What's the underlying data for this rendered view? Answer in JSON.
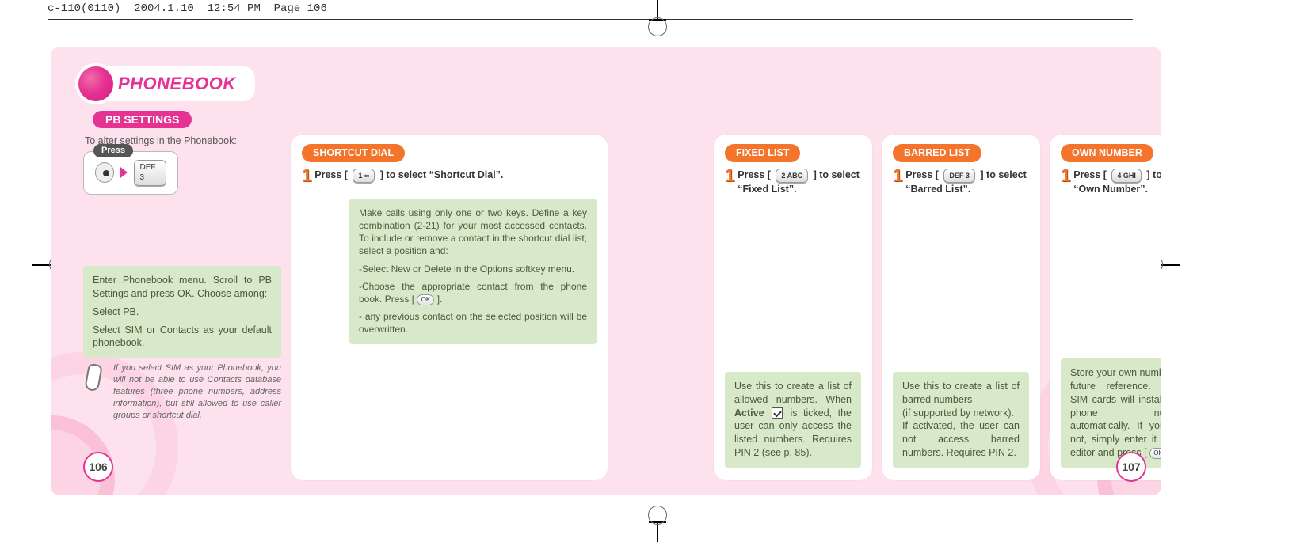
{
  "file_header": "c-110(0110)  2004.1.10  12:54 PM  Page 106",
  "title": "PHONEBOOK",
  "section": "PB SETTINGS",
  "page_left": "106",
  "page_right": "107",
  "intro": {
    "alter": "To alter settings in the Phonebook:",
    "press_label": "Press",
    "key_text": "DEF 3"
  },
  "enter_box": {
    "p1": "Enter Phonebook menu. Scroll to PB Settings and press OK. Choose among:",
    "p2": "Select PB.",
    "p3": "Select SIM or Contacts as your default phonebook."
  },
  "sim_note": "If you select SIM as your Phonebook, you will not be able to use Contacts database features (three phone numbers, address information), but still allowed to use caller groups or shortcut dial.",
  "shortcut": {
    "tag": "SHORTCUT DIAL",
    "step_before": "Press [ ",
    "step_key": "1 ∞",
    "step_after": " ] to select “Shortcut Dial”.",
    "g1": "Make calls using only one or two keys. Define a key combination (2-21) for your most accessed contacts. To include or remove a contact in the shortcut dial list, select a position and:",
    "g2": "-Select New or Delete in the Options softkey menu.",
    "g3a": "-Choose the appropriate contact from the phone book. Press [ ",
    "g3b": " ].",
    "g4": "-  any previous contact on the selected position will be overwritten."
  },
  "fixed": {
    "tag": "FIXED LIST",
    "step_before": "Press [ ",
    "step_key": "2 ABC",
    "step_after": " ] to select “Fixed List”.",
    "foot_a": "Use this to create a list of allowed numbers. When ",
    "foot_active": "Active",
    "foot_b": " is ticked, the user can only access the listed numbers. Requires PIN 2 (see p. 85)."
  },
  "barred": {
    "tag": "BARRED LIST",
    "step_before": "Press [ ",
    "step_key": "DEF 3",
    "step_after": " ] to select “Barred List”.",
    "foot_line1": "Use this to create a list of barred numbers",
    "foot_line2": "(if supported by network).",
    "foot_line3": "If activated, the user can not access barred numbers. Requires PIN 2."
  },
  "own": {
    "tag": "OWN NUMBER",
    "step_before": "Press [ ",
    "step_key": "4 GHI",
    "step_after": " ] to select “Own Number”.",
    "foot_a": "Store your own number for future reference. Some SIM cards will install your phone number automatically. If yours is not, simply enter it in the editor and press [ ",
    "foot_b": " ]."
  }
}
